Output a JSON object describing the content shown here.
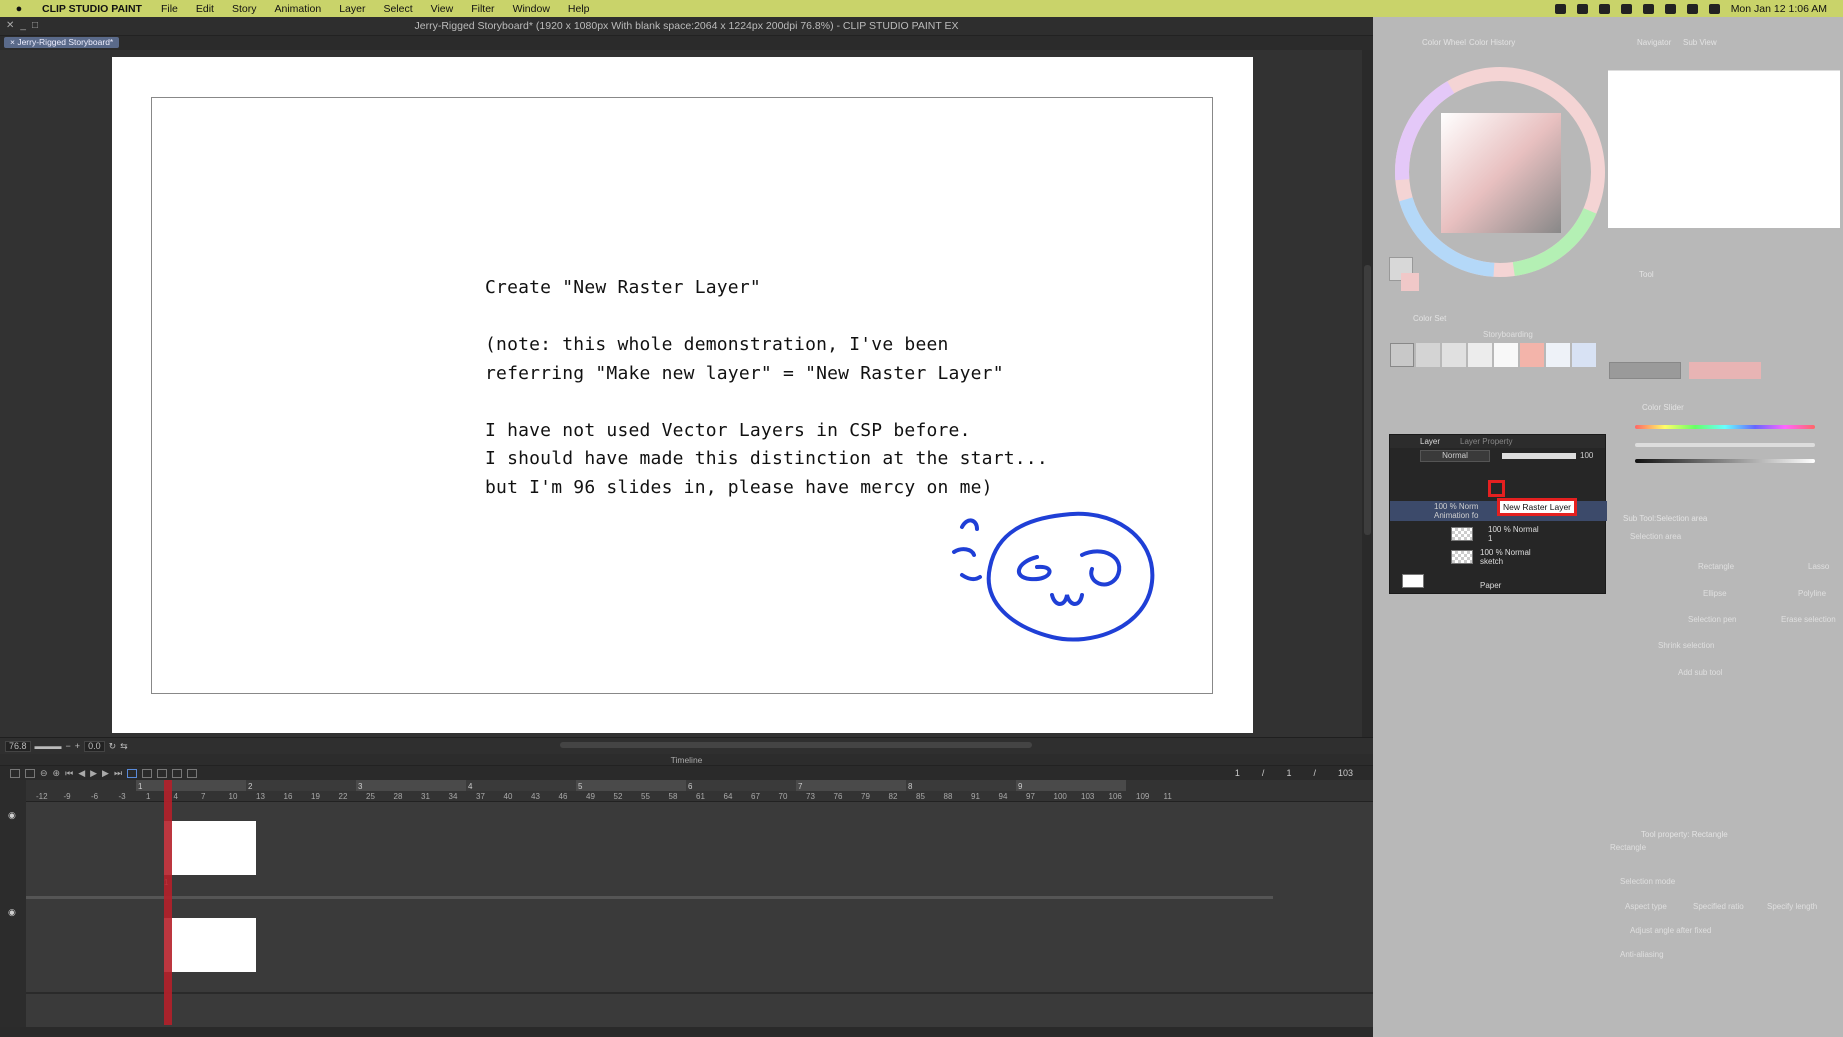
{
  "menubar": {
    "app_name": "CLIP STUDIO PAINT",
    "items": [
      "File",
      "Edit",
      "Story",
      "Animation",
      "Layer",
      "Select",
      "View",
      "Filter",
      "Window",
      "Help"
    ],
    "clock": "Mon Jan 12  1:06 AM"
  },
  "window": {
    "title": "Jerry-Rigged Storyboard* (1920 x 1080px With blank space:2064 x 1224px 200dpi 76.8%)  - CLIP STUDIO PAINT EX",
    "doc_tab": "× Jerry-Rigged Storyboard*"
  },
  "canvas": {
    "line1": "Create \"New Raster Layer\"",
    "line2": "(note: this whole demonstration, I've been",
    "line3": "referring \"Make new layer\" = \"New Raster Layer\"",
    "line4": "I have not used Vector Layers in CSP before.",
    "line5": "I should have made this distinction at the start...",
    "line6": "but I'm 96 slides in, please have mercy on me)"
  },
  "status": {
    "zoom": "76.8",
    "angle": "0.0"
  },
  "timeline": {
    "title": "Timeline",
    "counter": [
      "1",
      "/",
      "1",
      "/",
      "103"
    ],
    "sections": [
      "1",
      "2",
      "3",
      "4",
      "5",
      "6",
      "7",
      "8",
      "9"
    ],
    "ticks": [
      "-12",
      "-9",
      "-6",
      "-3",
      "1",
      "4",
      "7",
      "10",
      "13",
      "16",
      "19",
      "22",
      "25",
      "28",
      "31",
      "34",
      "37",
      "40",
      "43",
      "46",
      "49",
      "52",
      "55",
      "58",
      "61",
      "64",
      "67",
      "70",
      "73",
      "76",
      "79",
      "82",
      "85",
      "88",
      "91",
      "94",
      "97",
      "100",
      "103",
      "106",
      "109",
      "11"
    ],
    "cel_label": "1"
  },
  "panels": {
    "color_wheel": "Color Wheel",
    "color_history": "Color History",
    "navigator": "Navigator",
    "sub_view": "Sub View",
    "color_set": "Color Set",
    "color_set_name": "Storyboarding",
    "tool": "Tool",
    "color_slider": "Color Slider",
    "sub_tool": "Sub Tool:Selection area",
    "tool_property": "Tool property: Rectangle",
    "tool_property_name": "Rectangle",
    "selection_mode": "Selection mode",
    "aspect_type": "Aspect type",
    "specified_ratio": "Specified ratio",
    "specify_length": "Specify length",
    "adjust_angle": "Adjust angle after fixed",
    "anti_aliasing": "Anti-aliasing",
    "add_sub_tool": "Add sub tool",
    "subtools": [
      "Selection area",
      "Rectangle",
      "Lasso",
      "Ellipse",
      "Polyline",
      "Selection pen",
      "Erase selection",
      "Shrink selection"
    ]
  },
  "layer_panel": {
    "tab_layer": "Layer",
    "tab_property": "Layer Property",
    "blend_mode": "Normal",
    "opacity": "100",
    "tooltip": "New Raster Layer",
    "layers": [
      {
        "line1": "100 % Norm",
        "line2": "Animation fo"
      },
      {
        "line1": "100 % Normal",
        "line2": "1"
      },
      {
        "line1": "100 % Normal",
        "line2": "sketch"
      },
      {
        "line1": "Paper",
        "line2": ""
      }
    ]
  },
  "colors": {
    "accent_red": "#e52020",
    "menubar": "#c9d36a",
    "doodle_blue": "#1f3fd6"
  }
}
